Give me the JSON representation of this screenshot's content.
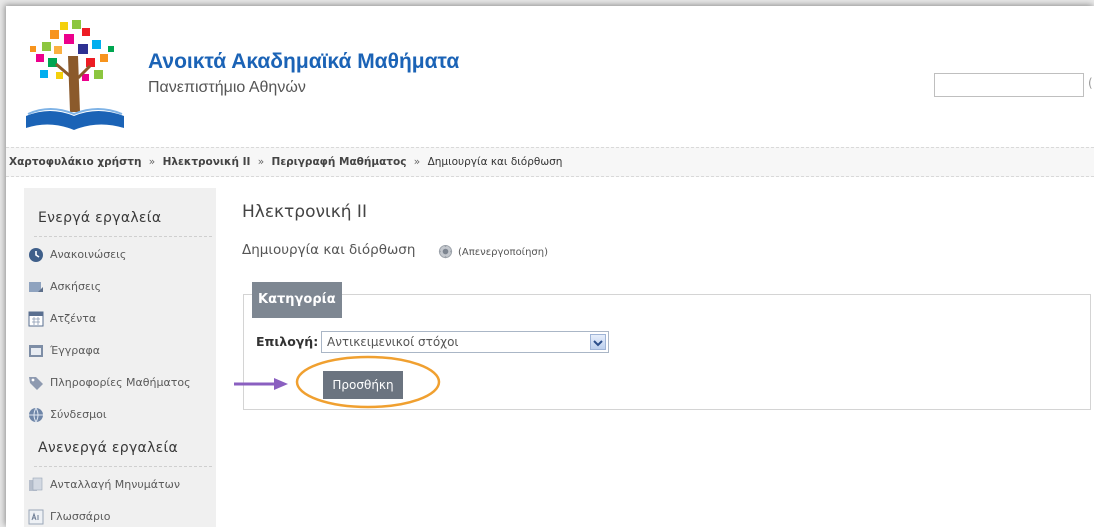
{
  "header": {
    "site_title": "Ανοικτά Ακαδημαϊκά Μαθήματα",
    "site_subtitle": "Πανεπιστήμιο Αθηνών",
    "search": {
      "value": "",
      "placeholder": ""
    }
  },
  "breadcrumb": {
    "items": [
      "Χαρτοφυλάκιο χρήστη",
      "Ηλεκτρονική ΙΙ",
      "Περιγραφή Μαθήματος"
    ],
    "separator": "»",
    "current": "Δημιουργία και διόρθωση"
  },
  "sidebar": {
    "active_heading": "Ενεργά εργαλεία",
    "active_items": [
      {
        "label": "Ανακοινώσεις",
        "icon": "announcements-icon"
      },
      {
        "label": "Ασκήσεις",
        "icon": "exercises-icon"
      },
      {
        "label": "Ατζέντα",
        "icon": "calendar-icon"
      },
      {
        "label": "Έγγραφα",
        "icon": "documents-icon"
      },
      {
        "label": "Πληροφορίες Μαθήματος",
        "icon": "tag-icon"
      },
      {
        "label": "Σύνδεσμοι",
        "icon": "globe-icon"
      }
    ],
    "inactive_heading": "Ανενεργά εργαλεία",
    "inactive_items": [
      {
        "label": "Ανταλλαγή Μηνυμάτων",
        "icon": "messages-icon"
      },
      {
        "label": "Γλωσσάριο",
        "icon": "glossary-icon"
      }
    ]
  },
  "main": {
    "course_title": "Ηλεκτρονική ΙΙ",
    "page_title": "Δημιουργία και διόρθωση",
    "deactivate_link": "(Απενεργοποίηση)",
    "panel": {
      "header": "Κατηγορία",
      "field_label": "Επιλογή:",
      "select_value": "Αντικειμενικοί στόχοι",
      "add_button": "Προσθήκη"
    }
  },
  "colors": {
    "brand_blue": "#1b63b6",
    "panel_header": "#7e8792",
    "button": "#6b7480",
    "annotation_ellipse": "#f0a030",
    "annotation_arrow": "#8a5fc0"
  }
}
